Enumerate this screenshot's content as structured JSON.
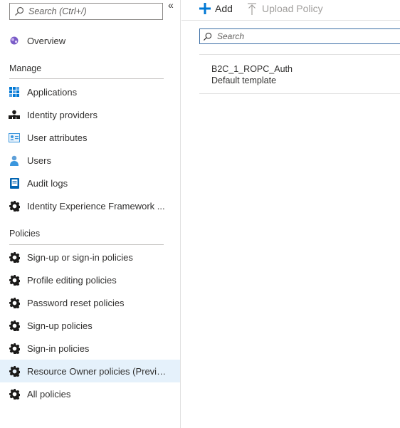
{
  "sidebar": {
    "search_placeholder": "Search (Ctrl+/)",
    "collapse_glyph": "«",
    "overview": {
      "label": "Overview",
      "icon": "overview-icon"
    },
    "sections": [
      {
        "title": "Manage",
        "items": [
          {
            "label": "Applications",
            "icon": "applications-icon"
          },
          {
            "label": "Identity providers",
            "icon": "identity-providers-icon"
          },
          {
            "label": "User attributes",
            "icon": "user-attributes-icon"
          },
          {
            "label": "Users",
            "icon": "users-icon"
          },
          {
            "label": "Audit logs",
            "icon": "audit-logs-icon"
          },
          {
            "label": "Identity Experience Framework ...",
            "icon": "gear-icon"
          }
        ]
      },
      {
        "title": "Policies",
        "items": [
          {
            "label": "Sign-up or sign-in policies",
            "icon": "gear-icon"
          },
          {
            "label": "Profile editing policies",
            "icon": "gear-icon"
          },
          {
            "label": "Password reset policies",
            "icon": "gear-icon"
          },
          {
            "label": "Sign-up policies",
            "icon": "gear-icon"
          },
          {
            "label": "Sign-in policies",
            "icon": "gear-icon"
          },
          {
            "label": "Resource Owner policies (Previe...",
            "icon": "gear-icon",
            "selected": true
          },
          {
            "label": "All policies",
            "icon": "gear-icon"
          }
        ]
      }
    ]
  },
  "toolbar": {
    "add_label": "Add",
    "upload_label": "Upload Policy"
  },
  "main": {
    "search_placeholder": "Search",
    "policies": [
      {
        "name": "B2C_1_ROPC_Auth",
        "description": "Default template"
      }
    ]
  },
  "colors": {
    "accent": "#0078d4",
    "selected_bg": "#e5f1fb",
    "gear": "#1b1a19"
  }
}
